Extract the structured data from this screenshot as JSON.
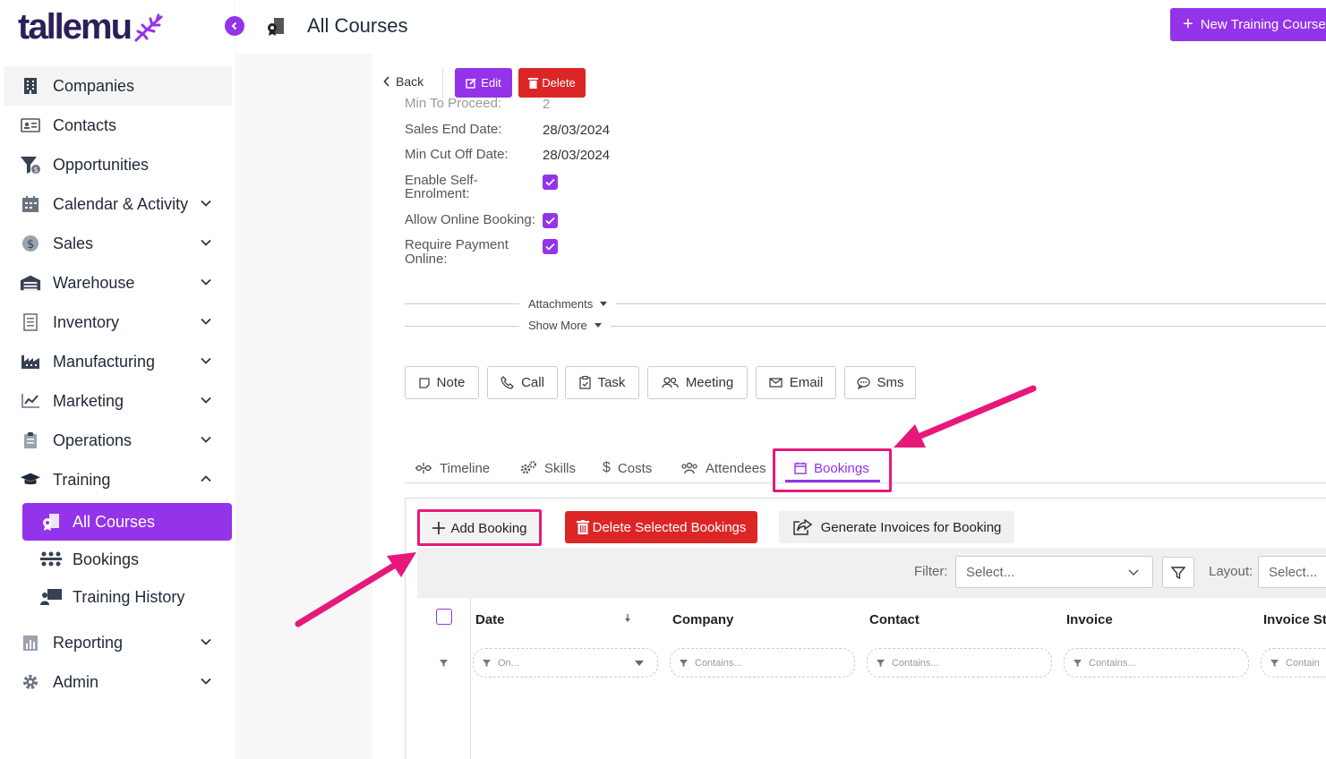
{
  "brand": {
    "name": "tallemu",
    "accent": "#9333ea",
    "danger": "#dc2626",
    "highlight": "#e6197a"
  },
  "sidebar": {
    "items": [
      {
        "label": "Companies",
        "icon": "building-icon"
      },
      {
        "label": "Contacts",
        "icon": "id-card-icon"
      },
      {
        "label": "Opportunities",
        "icon": "funnel-dollar-icon"
      },
      {
        "label": "Calendar & Activity",
        "icon": "calendar-icon"
      },
      {
        "label": "Sales",
        "icon": "dollar-circle-icon"
      },
      {
        "label": "Warehouse",
        "icon": "warehouse-icon"
      },
      {
        "label": "Inventory",
        "icon": "clipboard-list-icon"
      },
      {
        "label": "Manufacturing",
        "icon": "factory-icon"
      },
      {
        "label": "Marketing",
        "icon": "chart-line-icon"
      },
      {
        "label": "Operations",
        "icon": "clipboard-icon"
      },
      {
        "label": "Training",
        "icon": "graduation-cap-icon"
      },
      {
        "label": "Reporting",
        "icon": "bar-chart-icon"
      },
      {
        "label": "Admin",
        "icon": "gear-icon"
      }
    ],
    "training_sub": [
      {
        "label": "All Courses",
        "icon": "course-icon"
      },
      {
        "label": "Bookings",
        "icon": "people-icon"
      },
      {
        "label": "Training History",
        "icon": "presenter-icon"
      }
    ]
  },
  "header": {
    "title": "All Courses",
    "new_button": "New Training Course"
  },
  "detail": {
    "back": "Back",
    "edit": "Edit",
    "delete": "Delete",
    "fields": {
      "min_to_proceed_label": "Min To Proceed:",
      "min_to_proceed_value": "2",
      "sales_end_label": "Sales End Date:",
      "sales_end_value": "28/03/2024",
      "min_cutoff_label": "Min Cut Off Date:",
      "min_cutoff_value": "28/03/2024",
      "self_enrol_label_1": "Enable Self-",
      "self_enrol_label_2": "Enrolment:",
      "online_booking_label": "Allow Online Booking:",
      "require_payment_label_1": "Require Payment",
      "require_payment_label_2": "Online:"
    },
    "attachments": "Attachments",
    "show_more": "Show More"
  },
  "actions": [
    "Note",
    "Call",
    "Task",
    "Meeting",
    "Email",
    "Sms"
  ],
  "tabs": [
    "Timeline",
    "Skills",
    "Costs",
    "Attendees",
    "Bookings"
  ],
  "bookings": {
    "add": "Add Booking",
    "delete_selected": "Delete Selected Bookings",
    "generate_invoices": "Generate Invoices for Booking",
    "filter_label": "Filter:",
    "filter_placeholder": "Select...",
    "layout_label": "Layout:",
    "layout_placeholder": "Select...",
    "columns": [
      "Date",
      "Company",
      "Contact",
      "Invoice",
      "Invoice Sta"
    ],
    "filters": [
      "On...",
      "Contains...",
      "Contains...",
      "Contains...",
      "Contain"
    ]
  }
}
